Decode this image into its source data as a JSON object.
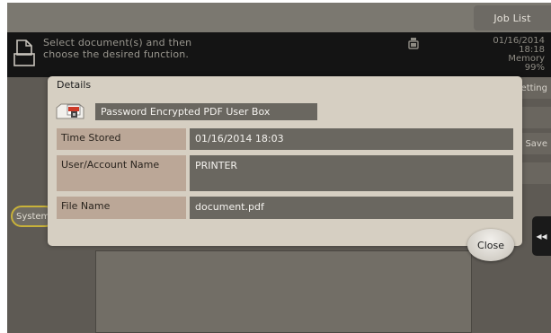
{
  "header": {
    "job_list_label": "Job List",
    "message_line1": "Select document(s) and then",
    "message_line2": "choose the desired function.",
    "date": "01/16/2014",
    "time": "18:18",
    "memory_label": "Memory",
    "memory_value": "99%"
  },
  "background": {
    "side_buttons": [
      "Setting",
      "",
      "Save",
      ""
    ],
    "system_label": "System",
    "collapse_glyph": "◂◂"
  },
  "dialog": {
    "title": "Details",
    "box_icon": "pdf-box-icon",
    "box_name": "Password Encrypted PDF User Box",
    "rows": [
      {
        "label": "Time Stored",
        "value": "01/16/2014 18:03"
      },
      {
        "label": "User/Account Name",
        "value": "PRINTER"
      },
      {
        "label": "File Name",
        "value": "document.pdf"
      }
    ],
    "close_label": "Close"
  },
  "colors": {
    "background": "#5e5a54",
    "message_bar": "#141414",
    "dialog": "#d6cfc2",
    "label_cell": "#bba797",
    "value_cell": "#6a6760",
    "accent": "#c8b23a"
  }
}
